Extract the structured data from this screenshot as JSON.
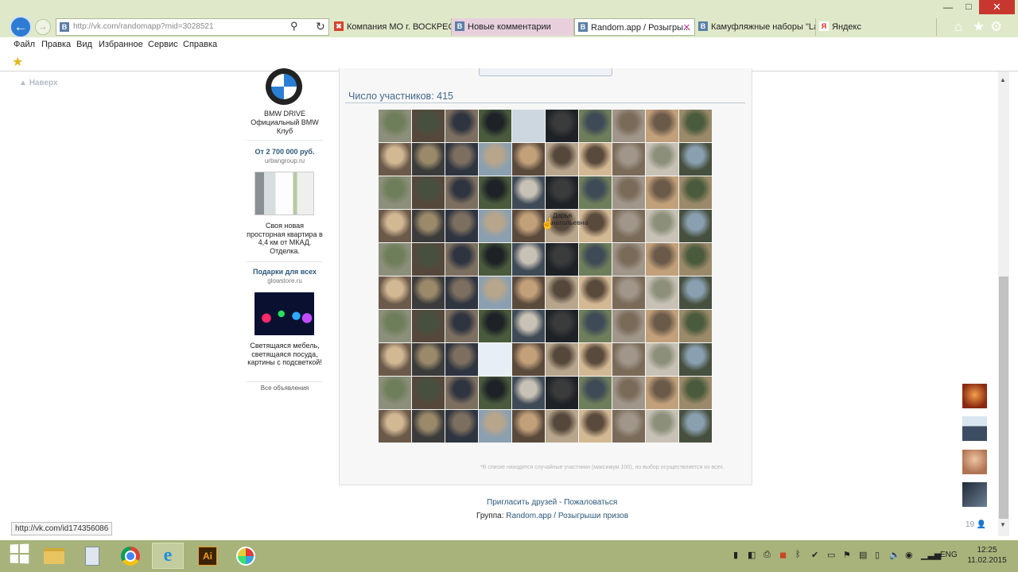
{
  "browser": {
    "address": "http://vk.com/randomapp?mid=3028521",
    "tabs": [
      {
        "label": "Компания МО г. ВОСКРЕС...",
        "favicon": "V-icon-red",
        "active": false
      },
      {
        "label": "Новые комментарии",
        "favicon": "vk-icon",
        "active": false
      },
      {
        "label": "Random.app / Розыгры...",
        "favicon": "vk-icon",
        "active": true,
        "close": "✕"
      },
      {
        "label": "Камуфляжные наборы \"La...",
        "favicon": "vk-icon",
        "active": false
      },
      {
        "label": "Яндекс",
        "favicon": "yandex-icon",
        "active": false
      }
    ],
    "menu": [
      "Файл",
      "Правка",
      "Вид",
      "Избранное",
      "Сервис",
      "Справка"
    ],
    "window_controls": {
      "min": "—",
      "max": "□",
      "close": "✕"
    },
    "favicon_letter": "В",
    "tab_favicon_letter": "В",
    "yandex_letter": "Я"
  },
  "page": {
    "scroll_up": "Наверх",
    "sidebar": {
      "ads": [
        {
          "title": "BMW DRIVE Официальный BMW Клуб"
        },
        {
          "headline": "От 2 700 000 руб.",
          "domain": "urbangroup.ru",
          "desc": "Своя новая просторная квартира в 4,4 км от МКАД. Отделка."
        },
        {
          "headline": "Подарки для всех",
          "domain": "glowstore.ru",
          "desc": "Светящаяся мебель, светящаяся посуда, картины с подсветкой!"
        }
      ],
      "all_ads": "Все объявления"
    },
    "participants_title": "Число участников: 415",
    "hover_name": "Дарья Анатольевна",
    "note": "*В списке находятся случайные участники (максимум 100), но выбор осуществляется из всех.",
    "footer": {
      "invite": "Пригласить друзей",
      "sep": " - ",
      "report": "Пожаловаться"
    },
    "group": {
      "prefix": "Группа: ",
      "link": "Random.app / Розыгрыши призов"
    },
    "online_count": "19",
    "status_url": "http://vk.com/id174356086"
  },
  "taskbar": {
    "apps": [
      "file-explorer-icon",
      "calculator-icon",
      "chrome-icon",
      "internet-explorer-icon",
      "illustrator-icon",
      "paint-icon"
    ],
    "illustrator_label": "Ai",
    "lang": "ENG",
    "time": "12:25",
    "date": "11.02.2015"
  },
  "colors": {
    "vk_blue": "#45688e",
    "link": "#2b587a",
    "chrome_green": "#dfe9c9",
    "taskbar": "#a7b37b"
  }
}
